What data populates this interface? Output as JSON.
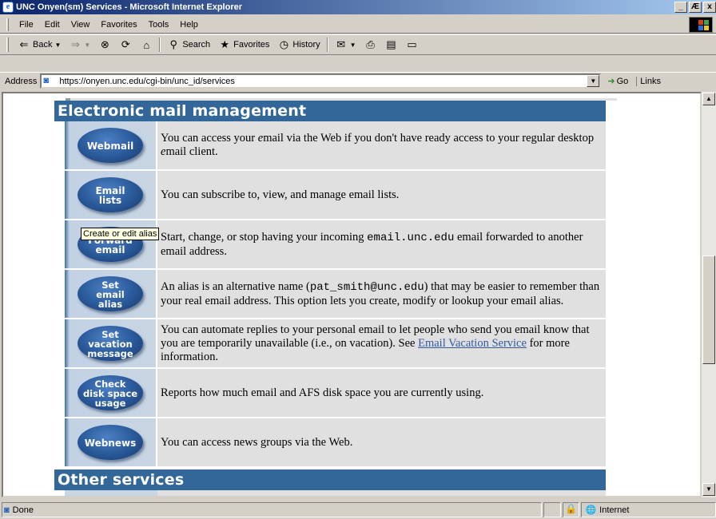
{
  "window": {
    "title": "UNC Onyen(sm) Services - Microsoft Internet Explorer",
    "buttons": [
      "_",
      "Æ",
      "x"
    ]
  },
  "menu": [
    "File",
    "Edit",
    "View",
    "Favorites",
    "Tools",
    "Help"
  ],
  "toolbar": {
    "back": "Back",
    "search": "Search",
    "favorites": "Favorites",
    "history": "History"
  },
  "address": {
    "label": "Address",
    "url": "https://onyen.unc.edu/cgi-bin/unc_id/services",
    "go": "Go",
    "links": "Links"
  },
  "sections": {
    "email_title": "Electronic mail management",
    "other_title": "Other services"
  },
  "services": [
    {
      "button": "Webmail",
      "desc_parts": [
        "You can access your ",
        "e",
        "mail via the Web if you don't have ready access to your regular desktop ",
        "e",
        "mail client."
      ]
    },
    {
      "button": "Email\nlists",
      "desc": "You can subscribe to, view, and manage email lists."
    },
    {
      "button": "Forward\nemail",
      "desc_a": "Start, change, or stop having your incoming ",
      "desc_mono": "email.unc.edu",
      "desc_b": " email forwarded to another email address."
    },
    {
      "button": "Set\nemail\nalias",
      "desc_a": "An alias is an alternative name (",
      "desc_mono": "pat_smith@unc.edu",
      "desc_b": ") that may be easier to remember than your real email address. This option lets you create, modify or lookup your email alias."
    },
    {
      "button": "Set\nvacation\nmessage",
      "desc_a": "You can automate replies to your personal email to let people who send you email know that you are temporarily unavailable (i.e., on vacation). See ",
      "link": "Email Vacation Service",
      "desc_b": " for more information."
    },
    {
      "button": "Check\ndisk space\nusage",
      "desc": "Reports how much email and AFS disk space you are currently using."
    },
    {
      "button": "Webnews",
      "desc": "You can access news groups via the Web."
    }
  ],
  "tooltip": "Create or edit alias",
  "status": {
    "text": "Done",
    "zone": "Internet"
  }
}
